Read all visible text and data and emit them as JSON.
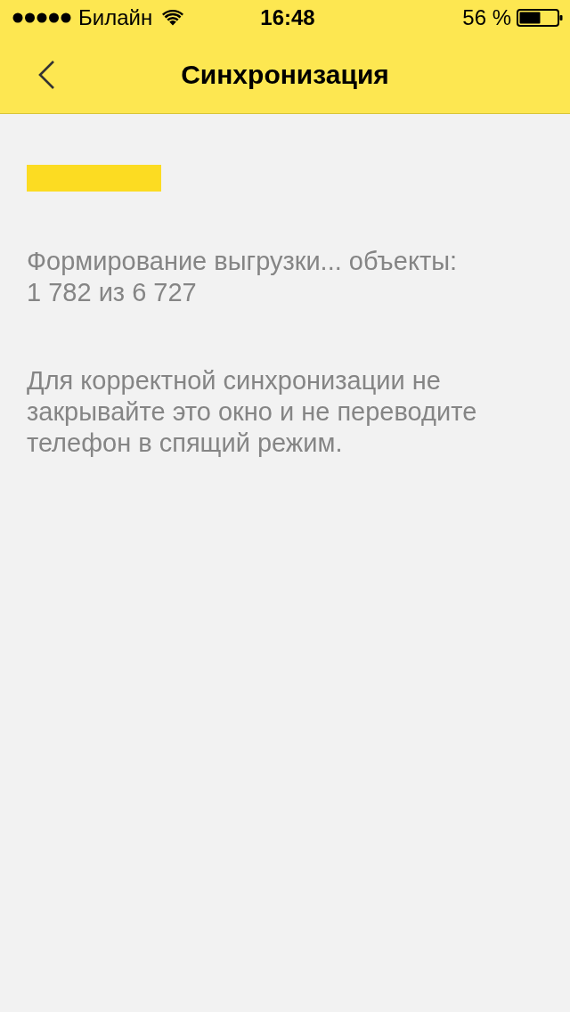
{
  "status_bar": {
    "carrier": "Билайн",
    "time": "16:48",
    "battery": "56 %"
  },
  "nav_bar": {
    "title": "Синхронизация"
  },
  "progress": {
    "level": 0.26,
    "label": "Формирование выгрузки... объекты:",
    "count": "1 782 из 6 727"
  },
  "notice": "Для корректной синхронизации не закрывайте это окно и не переводите телефон в спящий режим."
}
